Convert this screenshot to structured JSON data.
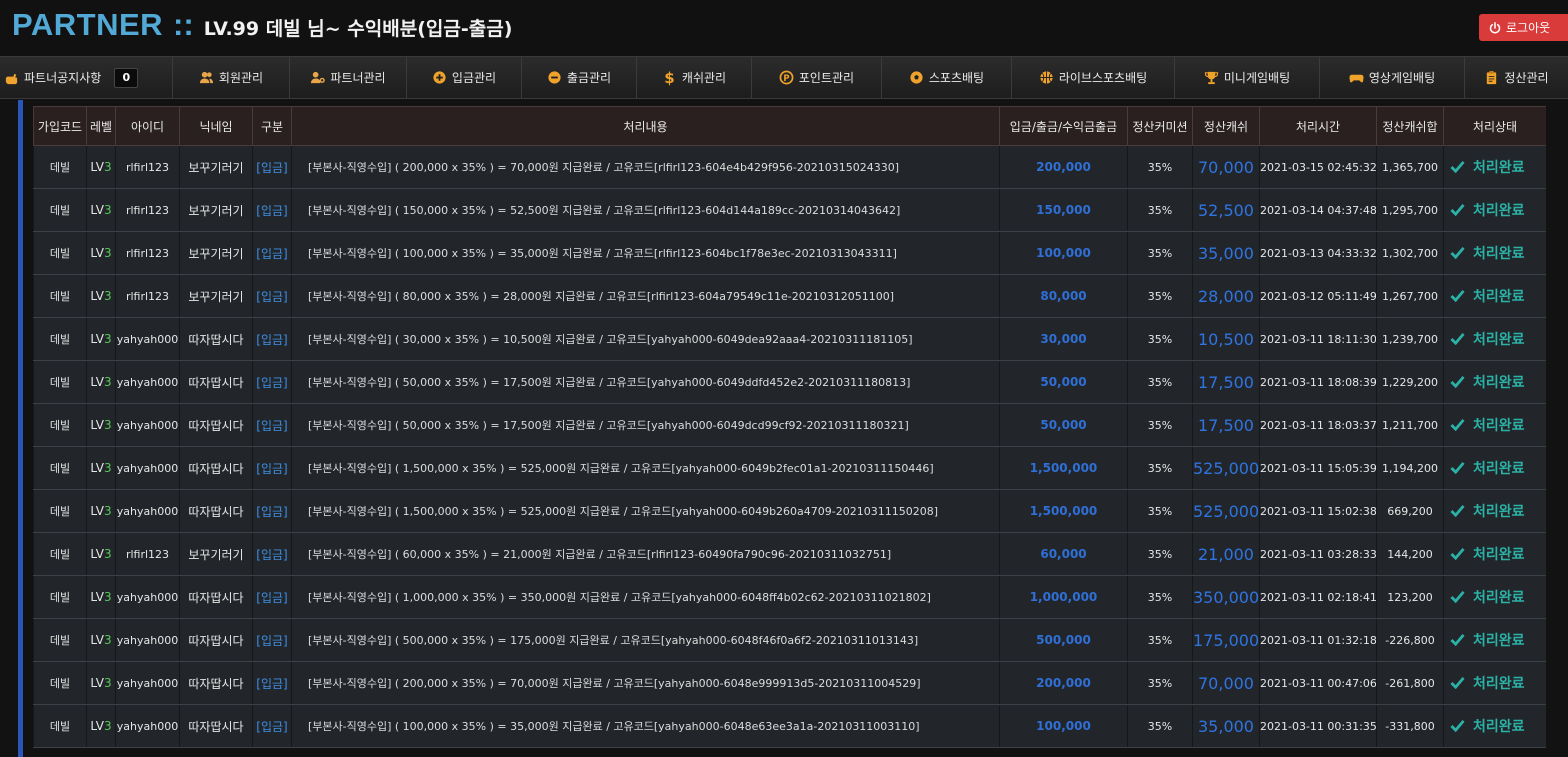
{
  "header": {
    "brand": "PARTNER",
    "separator": "::",
    "subtitle": "LV.99 데빌 님~ 수익배분(입금-출금)",
    "logout_label": "로그아웃"
  },
  "nav": {
    "items": [
      {
        "label": "파트너공지사항",
        "icon": "hand-pointer-icon",
        "badge": "0"
      },
      {
        "label": "회원관리",
        "icon": "users-icon"
      },
      {
        "label": "파트너관리",
        "icon": "user-gear-icon"
      },
      {
        "label": "입금관리",
        "icon": "plus-circle-icon"
      },
      {
        "label": "출금관리",
        "icon": "minus-circle-icon"
      },
      {
        "label": "캐쉬관리",
        "icon": "dollar-icon"
      },
      {
        "label": "포인트관리",
        "icon": "point-coin-icon"
      },
      {
        "label": "스포츠배팅",
        "icon": "soccer-ball-icon"
      },
      {
        "label": "라이브스포츠배팅",
        "icon": "basketball-icon"
      },
      {
        "label": "미니게임배팅",
        "icon": "trophy-icon"
      },
      {
        "label": "영상게임배팅",
        "icon": "gamepad-icon"
      },
      {
        "label": "정산관리",
        "icon": "clipboard-icon"
      }
    ]
  },
  "table": {
    "columns": [
      "가입코드",
      "레벨",
      "아이디",
      "닉네임",
      "구분",
      "처리내용",
      "입금/출금/수익금출금",
      "정산커미션",
      "정산캐쉬",
      "처리시간",
      "정산캐쉬합",
      "처리상태"
    ],
    "rows": [
      {
        "code": "데빌",
        "lv": "LV",
        "lvn": "3",
        "id": "rlfirl123",
        "nick": "보꾸기러기",
        "cat": "[입금]",
        "desc": "[부본사-직영수입] ( 200,000 x 35% ) = 70,000원 지급완료 / 고유코드[rlfirl123-604e4b429f956-20210315024330]",
        "amount": "200,000",
        "comm": "35%",
        "cash": "70,000",
        "time": "2021-03-15 02:45:32",
        "sum": "1,365,700",
        "status": "처리완료"
      },
      {
        "code": "데빌",
        "lv": "LV",
        "lvn": "3",
        "id": "rlfirl123",
        "nick": "보꾸기러기",
        "cat": "[입금]",
        "desc": "[부본사-직영수입] ( 150,000 x 35% ) = 52,500원 지급완료 / 고유코드[rlfirl123-604d144a189cc-20210314043642]",
        "amount": "150,000",
        "comm": "35%",
        "cash": "52,500",
        "time": "2021-03-14 04:37:48",
        "sum": "1,295,700",
        "status": "처리완료"
      },
      {
        "code": "데빌",
        "lv": "LV",
        "lvn": "3",
        "id": "rlfirl123",
        "nick": "보꾸기러기",
        "cat": "[입금]",
        "desc": "[부본사-직영수입] ( 100,000 x 35% ) = 35,000원 지급완료 / 고유코드[rlfirl123-604bc1f78e3ec-20210313043311]",
        "amount": "100,000",
        "comm": "35%",
        "cash": "35,000",
        "time": "2021-03-13 04:33:32",
        "sum": "1,302,700",
        "status": "처리완료"
      },
      {
        "code": "데빌",
        "lv": "LV",
        "lvn": "3",
        "id": "rlfirl123",
        "nick": "보꾸기러기",
        "cat": "[입금]",
        "desc": "[부본사-직영수입] ( 80,000 x 35% ) = 28,000원 지급완료 / 고유코드[rlfirl123-604a79549c11e-20210312051100]",
        "amount": "80,000",
        "comm": "35%",
        "cash": "28,000",
        "time": "2021-03-12 05:11:49",
        "sum": "1,267,700",
        "status": "처리완료"
      },
      {
        "code": "데빌",
        "lv": "LV",
        "lvn": "3",
        "id": "yahyah000",
        "nick": "따자땁시다",
        "cat": "[입금]",
        "desc": "[부본사-직영수입] ( 30,000 x 35% ) = 10,500원 지급완료 / 고유코드[yahyah000-6049dea92aaa4-20210311181105]",
        "amount": "30,000",
        "comm": "35%",
        "cash": "10,500",
        "time": "2021-03-11 18:11:30",
        "sum": "1,239,700",
        "status": "처리완료"
      },
      {
        "code": "데빌",
        "lv": "LV",
        "lvn": "3",
        "id": "yahyah000",
        "nick": "따자땁시다",
        "cat": "[입금]",
        "desc": "[부본사-직영수입] ( 50,000 x 35% ) = 17,500원 지급완료 / 고유코드[yahyah000-6049ddfd452e2-20210311180813]",
        "amount": "50,000",
        "comm": "35%",
        "cash": "17,500",
        "time": "2021-03-11 18:08:39",
        "sum": "1,229,200",
        "status": "처리완료"
      },
      {
        "code": "데빌",
        "lv": "LV",
        "lvn": "3",
        "id": "yahyah000",
        "nick": "따자땁시다",
        "cat": "[입금]",
        "desc": "[부본사-직영수입] ( 50,000 x 35% ) = 17,500원 지급완료 / 고유코드[yahyah000-6049dcd99cf92-20210311180321]",
        "amount": "50,000",
        "comm": "35%",
        "cash": "17,500",
        "time": "2021-03-11 18:03:37",
        "sum": "1,211,700",
        "status": "처리완료"
      },
      {
        "code": "데빌",
        "lv": "LV",
        "lvn": "3",
        "id": "yahyah000",
        "nick": "따자땁시다",
        "cat": "[입금]",
        "desc": "[부본사-직영수입] ( 1,500,000 x 35% ) = 525,000원 지급완료 / 고유코드[yahyah000-6049b2fec01a1-20210311150446]",
        "amount": "1,500,000",
        "comm": "35%",
        "cash": "525,000",
        "time": "2021-03-11 15:05:39",
        "sum": "1,194,200",
        "status": "처리완료"
      },
      {
        "code": "데빌",
        "lv": "LV",
        "lvn": "3",
        "id": "yahyah000",
        "nick": "따자땁시다",
        "cat": "[입금]",
        "desc": "[부본사-직영수입] ( 1,500,000 x 35% ) = 525,000원 지급완료 / 고유코드[yahyah000-6049b260a4709-20210311150208]",
        "amount": "1,500,000",
        "comm": "35%",
        "cash": "525,000",
        "time": "2021-03-11 15:02:38",
        "sum": "669,200",
        "status": "처리완료"
      },
      {
        "code": "데빌",
        "lv": "LV",
        "lvn": "3",
        "id": "rlfirl123",
        "nick": "보꾸기러기",
        "cat": "[입금]",
        "desc": "[부본사-직영수입] ( 60,000 x 35% ) = 21,000원 지급완료 / 고유코드[rlfirl123-60490fa790c96-20210311032751]",
        "amount": "60,000",
        "comm": "35%",
        "cash": "21,000",
        "time": "2021-03-11 03:28:33",
        "sum": "144,200",
        "status": "처리완료"
      },
      {
        "code": "데빌",
        "lv": "LV",
        "lvn": "3",
        "id": "yahyah000",
        "nick": "따자땁시다",
        "cat": "[입금]",
        "desc": "[부본사-직영수입] ( 1,000,000 x 35% ) = 350,000원 지급완료 / 고유코드[yahyah000-6048ff4b02c62-20210311021802]",
        "amount": "1,000,000",
        "comm": "35%",
        "cash": "350,000",
        "time": "2021-03-11 02:18:41",
        "sum": "123,200",
        "status": "처리완료"
      },
      {
        "code": "데빌",
        "lv": "LV",
        "lvn": "3",
        "id": "yahyah000",
        "nick": "따자땁시다",
        "cat": "[입금]",
        "desc": "[부본사-직영수입] ( 500,000 x 35% ) = 175,000원 지급완료 / 고유코드[yahyah000-6048f46f0a6f2-20210311013143]",
        "amount": "500,000",
        "comm": "35%",
        "cash": "175,000",
        "time": "2021-03-11 01:32:18",
        "sum": "-226,800",
        "status": "처리완료"
      },
      {
        "code": "데빌",
        "lv": "LV",
        "lvn": "3",
        "id": "yahyah000",
        "nick": "따자땁시다",
        "cat": "[입금]",
        "desc": "[부본사-직영수입] ( 200,000 x 35% ) = 70,000원 지급완료 / 고유코드[yahyah000-6048e999913d5-20210311004529]",
        "amount": "200,000",
        "comm": "35%",
        "cash": "70,000",
        "time": "2021-03-11 00:47:06",
        "sum": "-261,800",
        "status": "처리완료"
      },
      {
        "code": "데빌",
        "lv": "LV",
        "lvn": "3",
        "id": "yahyah000",
        "nick": "따자땁시다",
        "cat": "[입금]",
        "desc": "[부본사-직영수입] ( 100,000 x 35% ) = 35,000원 지급완료 / 고유코드[yahyah000-6048e63ee3a1a-20210311003110]",
        "amount": "100,000",
        "comm": "35%",
        "cash": "35,000",
        "time": "2021-03-11 00:31:35",
        "sum": "-331,800",
        "status": "처리완료"
      }
    ]
  },
  "colors": {
    "brand": "#52a9d6",
    "logout": "#d93a3a",
    "link_blue": "#2f74e0",
    "status_teal": "#2bb2a6",
    "level_green": "#58c858"
  }
}
